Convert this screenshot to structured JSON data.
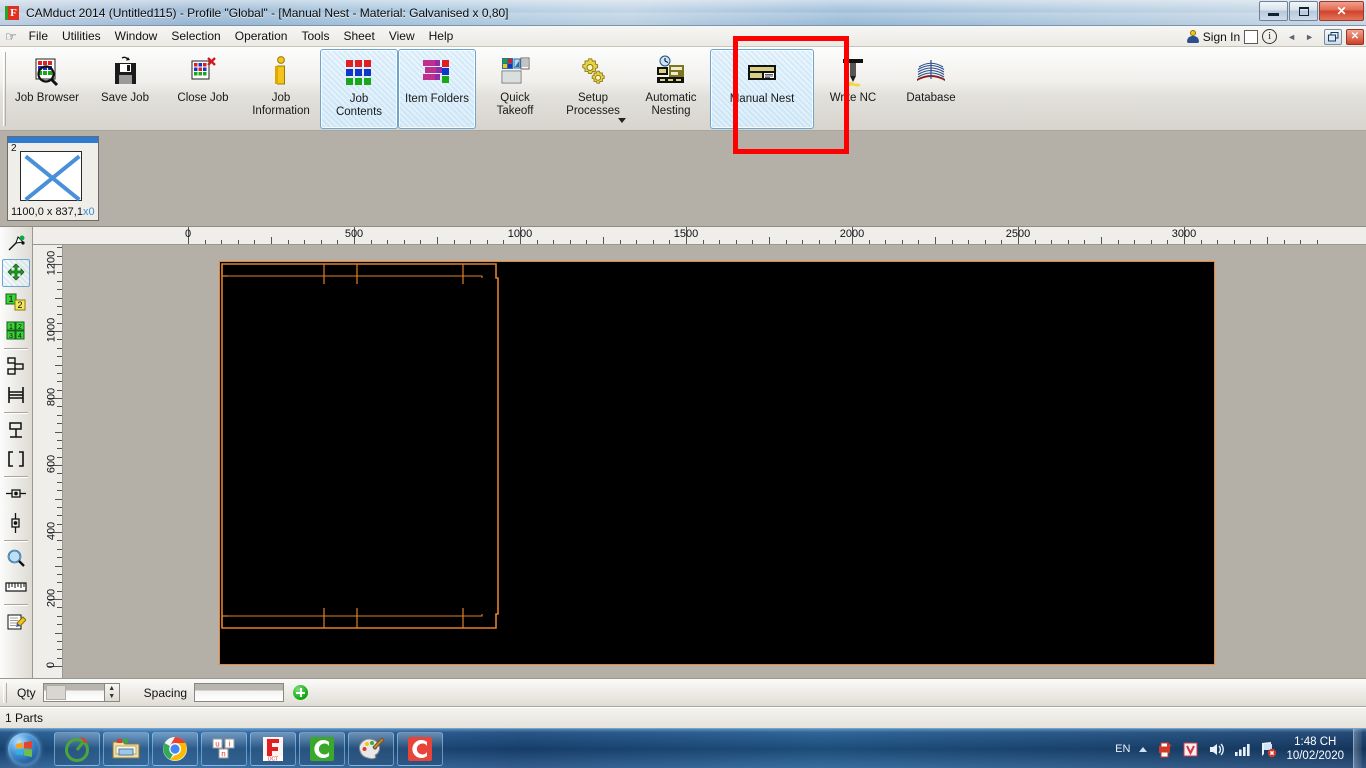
{
  "window": {
    "title": "CAMduct 2014 (Untitled115) - Profile \"Global\" - [Manual Nest  - Material: Galvanised x 0,80]",
    "app_icon": "camduct-icon",
    "minimize": "minimize-icon",
    "maximize": "restore-icon",
    "close": "close-icon"
  },
  "menubar": {
    "hand_icon": "pointing-hand-icon",
    "items": [
      {
        "label": "File"
      },
      {
        "label": "Utilities"
      },
      {
        "label": "Window"
      },
      {
        "label": "Selection"
      },
      {
        "label": "Operation"
      },
      {
        "label": "Tools"
      },
      {
        "label": "Sheet"
      },
      {
        "label": "View"
      },
      {
        "label": "Help"
      }
    ],
    "sign_in": "Sign In",
    "sign_in_icon": "user-icon",
    "info_icon": "info-icon",
    "checkbox_icon": "empty-checkbox-icon",
    "prev_icon": "◄",
    "next_icon": "►",
    "mdi_restore": "mdi-restore-icon",
    "mdi_close": "✕"
  },
  "ribbon": {
    "buttons": [
      {
        "label": "Job Browser",
        "icon": "job-browser-icon",
        "selected": false
      },
      {
        "label": "Save Job",
        "icon": "save-job-icon",
        "selected": false
      },
      {
        "label": "Close Job",
        "icon": "close-job-icon",
        "selected": false
      },
      {
        "label": "Job\nInformation",
        "icon": "job-information-icon",
        "selected": false
      },
      {
        "label": "Job\nContents",
        "icon": "job-contents-icon",
        "selected": true
      },
      {
        "label": "Item Folders",
        "icon": "item-folders-icon",
        "selected": true
      },
      {
        "label": "Quick\nTakeoff",
        "icon": "quick-takeoff-icon",
        "selected": false
      },
      {
        "label": "Setup\nProcesses",
        "icon": "setup-processes-icon",
        "selected": false,
        "dropdown": true
      },
      {
        "label": "Automatic\nNesting",
        "icon": "automatic-nesting-icon",
        "selected": false
      },
      {
        "label": "Manual Nest",
        "icon": "manual-nest-icon",
        "selected": true,
        "highlighted": true
      },
      {
        "label": "Write NC",
        "icon": "write-nc-icon",
        "selected": false
      },
      {
        "label": "Database",
        "icon": "database-icon",
        "selected": false
      }
    ],
    "highlight_color": "#ff0000"
  },
  "sheet_thumbnail": {
    "number": "2",
    "dimensions": "1100,0 x 837,1",
    "count_suffix": "x0",
    "selected": true
  },
  "left_toolbar": {
    "items": [
      {
        "name": "select-arrow-tool",
        "selected": false
      },
      {
        "name": "move-part-tool",
        "selected": true
      },
      {
        "name": "renumber-two-parts-tool",
        "selected": false
      },
      {
        "name": "renumber-all-parts-tool",
        "selected": false
      },
      {
        "name": "align-parts-tool",
        "selected": false
      },
      {
        "name": "mirror-part-tool",
        "selected": false
      },
      {
        "name": "rotate-part-tool",
        "selected": false
      },
      {
        "name": "bounding-box-tool",
        "selected": false
      },
      {
        "name": "horizontal-fit-tool",
        "selected": false
      },
      {
        "name": "vertical-fit-tool",
        "selected": false
      },
      {
        "name": "zoom-tool",
        "selected": false
      },
      {
        "name": "measure-tool",
        "selected": false
      },
      {
        "name": "annotate-tool",
        "selected": false
      }
    ]
  },
  "rulers": {
    "horizontal": {
      "ticks": [
        "0",
        "500",
        "1000",
        "1500",
        "2000",
        "2500",
        "3000"
      ],
      "unit_step": 500
    },
    "vertical": {
      "ticks": [
        "1200",
        "1000",
        "800",
        "600",
        "400",
        "200",
        "0"
      ],
      "unit_step": 200
    }
  },
  "canvas": {
    "sheet_border_color": "#e08a3c",
    "sheet_fill_color": "#000000",
    "part_outline_color": "#e0802a",
    "background_color": "#b4b0a8"
  },
  "bottom_bar": {
    "qty_label": "Qty",
    "qty_value": "",
    "spacing_label": "Spacing",
    "spacing_value": "",
    "add_button_icon": "add-green-plus-icon",
    "spin_up": "▲",
    "spin_down": "▼"
  },
  "status_bar": {
    "text": "1 Parts"
  },
  "taskbar": {
    "start_icon": "windows-start-orb-icon",
    "items": [
      {
        "name": "taskbar-item-camduct-green",
        "icon": "green-circle-icon"
      },
      {
        "name": "taskbar-item-explorer",
        "icon": "folder-icon"
      },
      {
        "name": "taskbar-item-chrome",
        "icon": "chrome-icon"
      },
      {
        "name": "taskbar-item-unikey",
        "icon": "unikey-icon"
      },
      {
        "name": "taskbar-item-foxit",
        "icon": "foxit-reader-icon"
      },
      {
        "name": "taskbar-item-camduct",
        "icon": "camduct-c-green-icon"
      },
      {
        "name": "taskbar-item-paint",
        "icon": "paint-icon"
      },
      {
        "name": "taskbar-item-camduct-red",
        "icon": "camduct-c-red-icon"
      }
    ],
    "tray": {
      "language": "EN",
      "show_hidden_icon": "caret-up-icon",
      "icons": [
        {
          "name": "tray-printer-icon"
        },
        {
          "name": "tray-unikey-v-icon"
        },
        {
          "name": "tray-volume-icon"
        },
        {
          "name": "tray-network-icon"
        },
        {
          "name": "tray-action-center-icon"
        }
      ],
      "time": "1:48 CH",
      "date": "10/02/2020"
    },
    "show_desktop": "show-desktop-button"
  }
}
